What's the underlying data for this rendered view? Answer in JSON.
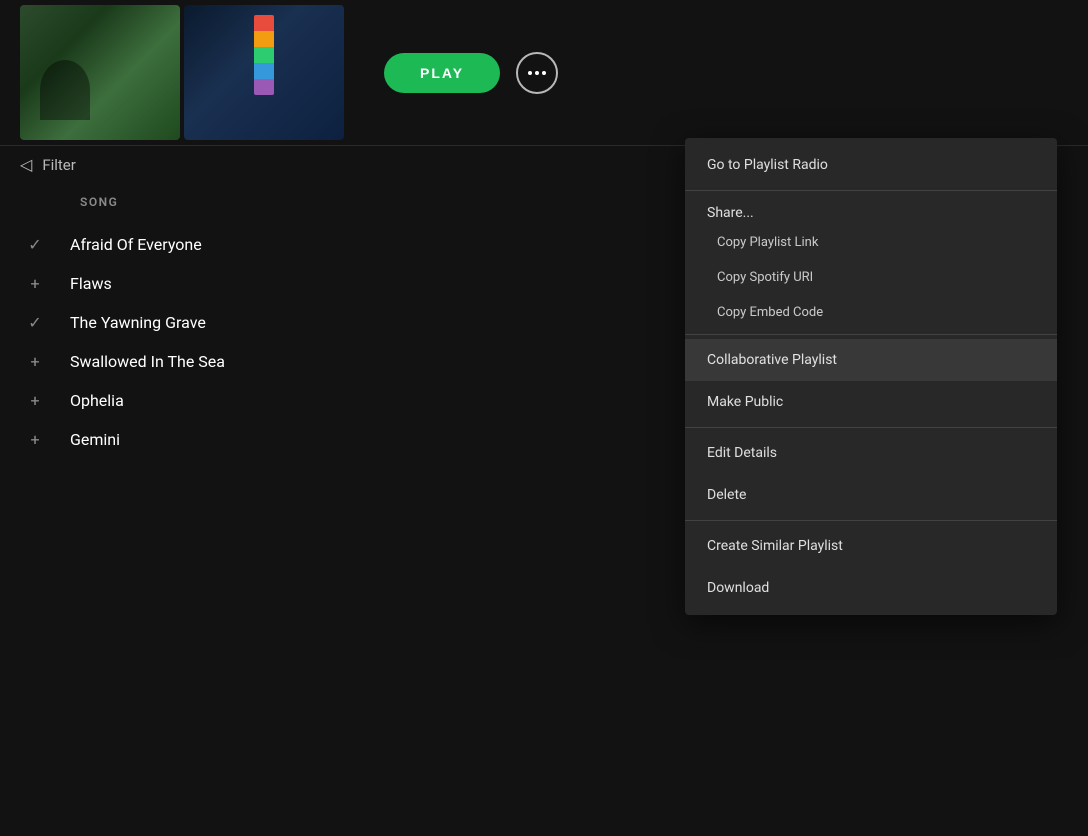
{
  "top": {
    "play_button": "PLAY",
    "more_button_label": "More options"
  },
  "filter": {
    "label": "Filter"
  },
  "song_list": {
    "header": "SONG",
    "songs": [
      {
        "name": "Afraid Of Everyone",
        "icon": "check"
      },
      {
        "name": "Flaws",
        "icon": "plus"
      },
      {
        "name": "The Yawning Grave",
        "icon": "check"
      },
      {
        "name": "Swallowed In The Sea",
        "icon": "plus"
      },
      {
        "name": "Ophelia",
        "icon": "plus"
      },
      {
        "name": "Gemini",
        "icon": "plus"
      }
    ]
  },
  "context_menu": {
    "items": [
      {
        "id": "go-to-playlist-radio",
        "label": "Go to Playlist Radio",
        "group": "main"
      },
      {
        "id": "share-header",
        "label": "Share...",
        "group": "share-header"
      },
      {
        "id": "copy-playlist-link",
        "label": "Copy Playlist Link",
        "group": "share"
      },
      {
        "id": "copy-spotify-uri",
        "label": "Copy Spotify URI",
        "group": "share"
      },
      {
        "id": "copy-embed-code",
        "label": "Copy Embed Code",
        "group": "share"
      },
      {
        "id": "collaborative-playlist",
        "label": "Collaborative Playlist",
        "group": "collab"
      },
      {
        "id": "make-public",
        "label": "Make Public",
        "group": "collab"
      },
      {
        "id": "edit-details",
        "label": "Edit Details",
        "group": "edit"
      },
      {
        "id": "delete",
        "label": "Delete",
        "group": "edit"
      },
      {
        "id": "create-similar-playlist",
        "label": "Create Similar Playlist",
        "group": "create"
      },
      {
        "id": "download",
        "label": "Download",
        "group": "create"
      }
    ]
  }
}
